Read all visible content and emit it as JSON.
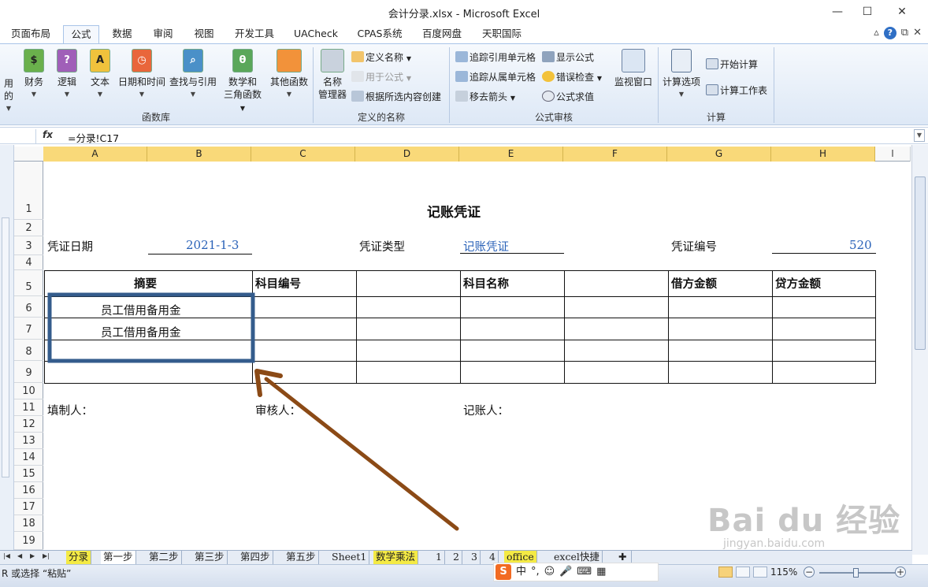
{
  "window": {
    "title": "会计分录.xlsx - Microsoft Excel",
    "controls": [
      "—",
      "☐",
      "✕"
    ]
  },
  "ribbon_tabs": [
    {
      "label": "页面布局",
      "active": false
    },
    {
      "label": "公式",
      "active": true
    },
    {
      "label": "数据",
      "active": false
    },
    {
      "label": "审阅",
      "active": false
    },
    {
      "label": "视图",
      "active": false
    },
    {
      "label": "开发工具",
      "active": false
    },
    {
      "label": "UACheck",
      "active": false
    },
    {
      "label": "CPAS系统",
      "active": false
    },
    {
      "label": "百度网盘",
      "active": false
    },
    {
      "label": "天职国际",
      "active": false
    }
  ],
  "ribbon": {
    "cut_label": "用的",
    "function_library": {
      "buttons": [
        {
          "label": "财务",
          "icon": "finance-book-icon",
          "color": "#6ab04c"
        },
        {
          "label": "逻辑",
          "icon": "logic-book-icon",
          "color": "#a05fb8"
        },
        {
          "label": "文本",
          "icon": "text-book-icon",
          "color": "#f0c23c"
        },
        {
          "label": "日期和时间",
          "icon": "datetime-book-icon",
          "color": "#e9663b"
        },
        {
          "label": "查找与引用",
          "icon": "lookup-book-icon",
          "color": "#4a90c8"
        },
        {
          "label": "数学和",
          "label2": "三角函数",
          "icon": "math-book-icon",
          "color": "#5aa75a"
        },
        {
          "label": "其他函数",
          "icon": "more-functions-icon",
          "color": "#f2923a"
        }
      ],
      "group_label": "函数库"
    },
    "defined_names": {
      "name_manager_line1": "名称",
      "name_manager_line2": "管理器",
      "define_name": "定义名称",
      "use_in_formula": "用于公式",
      "create_from_selection": "根据所选内容创建",
      "group_label": "定义的名称"
    },
    "formula_auditing": {
      "trace_precedents": "追踪引用单元格",
      "trace_dependents": "追踪从属单元格",
      "remove_arrows": "移去箭头",
      "show_formulas": "显示公式",
      "error_checking": "错误检查",
      "evaluate_formula": "公式求值",
      "watch_window": "监视窗口",
      "group_label": "公式审核"
    },
    "calculation": {
      "calc_options": "计算选项",
      "calc_now": "开始计算",
      "calc_sheet": "计算工作表",
      "group_label": "计算"
    }
  },
  "formula_bar": {
    "fx_label": "fx",
    "formula": "=分录!C17"
  },
  "columns": [
    "A",
    "B",
    "C",
    "D",
    "E",
    "F",
    "G",
    "H",
    "I"
  ],
  "selected_columns": [
    "A",
    "B",
    "C",
    "D",
    "E",
    "F",
    "G",
    "H"
  ],
  "rows": [
    "1",
    "2",
    "3",
    "4",
    "5",
    "6",
    "7",
    "8",
    "9",
    "10",
    "11",
    "12",
    "13",
    "14",
    "15",
    "16",
    "17",
    "18",
    "19"
  ],
  "voucher": {
    "title": "记账凭证",
    "date_label": "凭证日期",
    "date_value": "2021-1-3",
    "type_label": "凭证类型",
    "type_value": "记账凭证",
    "number_label": "凭证编号",
    "number_value": "520",
    "table_headers": {
      "summary": "摘要",
      "account_code": "科目编号",
      "account_name": "科目名称",
      "debit": "借方金额",
      "credit": "贷方金额"
    },
    "rows": [
      {
        "summary": "员工借用备用金"
      },
      {
        "summary": "员工借用备用金"
      },
      {
        "summary": ""
      },
      {
        "summary": ""
      }
    ],
    "prepared_by": "填制人：",
    "reviewed_by": "审核人：",
    "recorded_by": "记账人："
  },
  "annotations": {
    "highlight_box_color": "#345c8c",
    "arrow_color": "#8b4a16"
  },
  "sheet_tabs": [
    {
      "label": "分录",
      "style": "yellow"
    },
    {
      "label": "第一步",
      "style": "active"
    },
    {
      "label": "第二步",
      "style": "normal"
    },
    {
      "label": "第三步",
      "style": "normal"
    },
    {
      "label": "第四步",
      "style": "normal"
    },
    {
      "label": "第五步",
      "style": "normal"
    },
    {
      "label": "Sheet1",
      "style": "normal"
    },
    {
      "label": "数学乘法",
      "style": "yellow"
    },
    {
      "label": "1",
      "style": "normal"
    },
    {
      "label": "2",
      "style": "normal"
    },
    {
      "label": "3",
      "style": "normal"
    },
    {
      "label": "4",
      "style": "normal"
    },
    {
      "label": "office",
      "style": "yellow"
    },
    {
      "label": "excel快捷",
      "style": "normal"
    }
  ],
  "status_bar": {
    "message": "R 或选择 “粘贴”",
    "zoom": "115%"
  },
  "ime": {
    "logo": "S",
    "mode": "中",
    "punct": "°,"
  },
  "watermark": {
    "brand": "Bai du 经验",
    "site": "jingyan.baidu.com"
  }
}
